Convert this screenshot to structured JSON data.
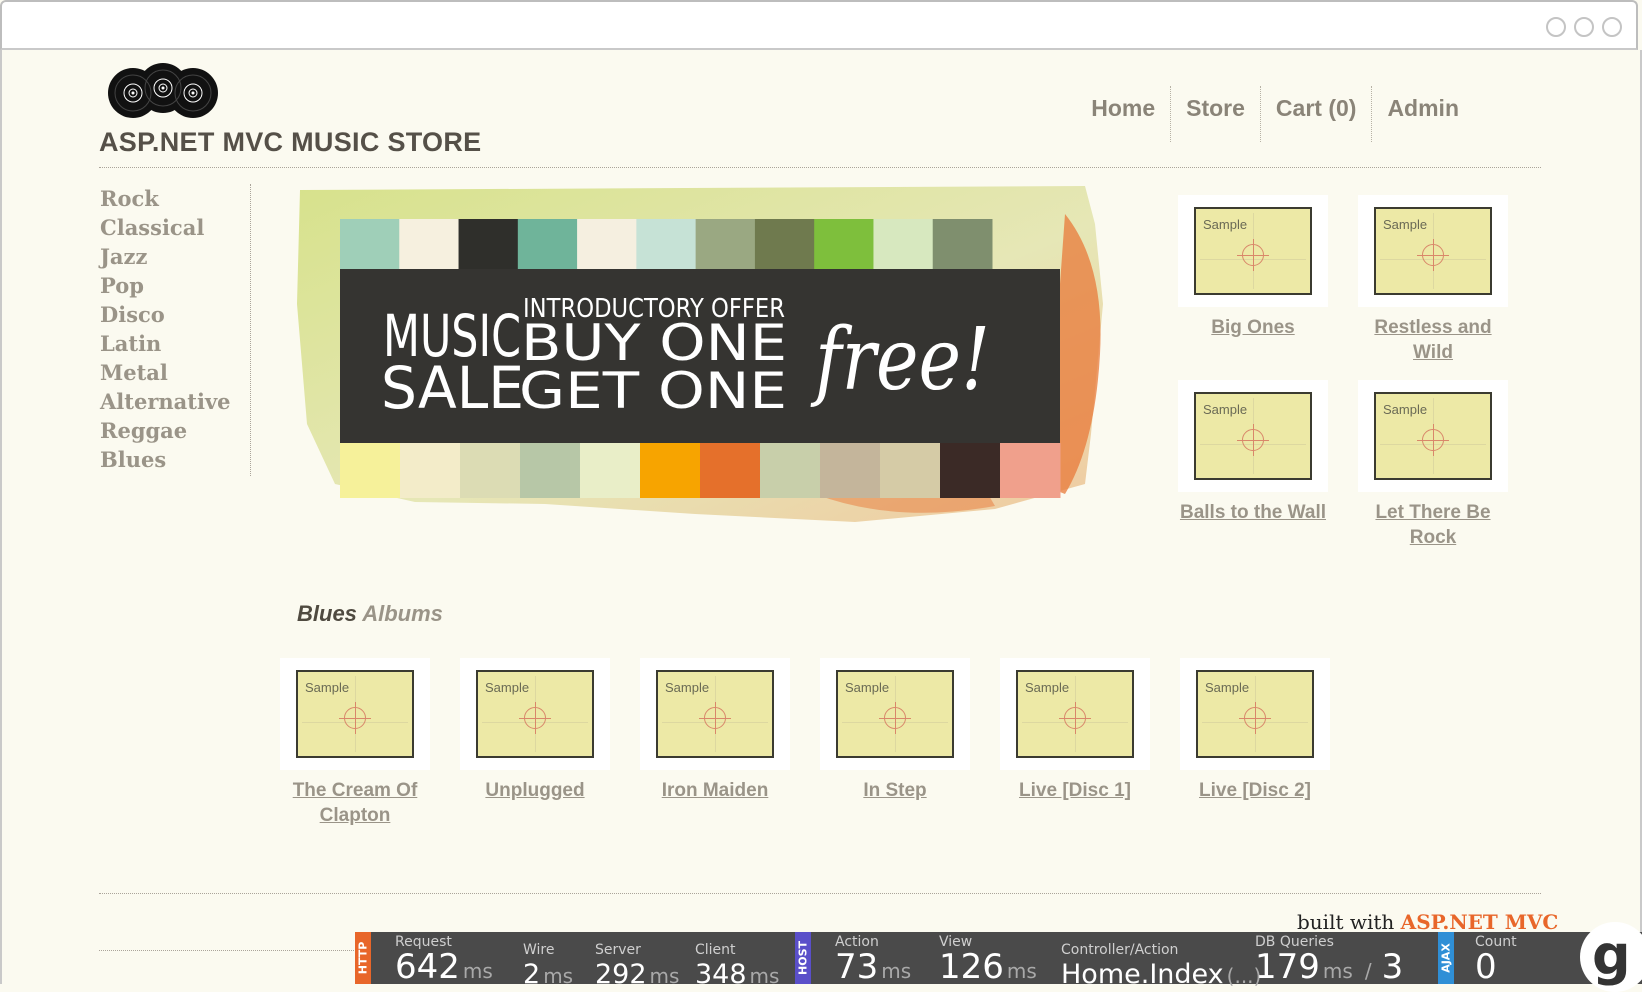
{
  "site": {
    "title": "ASP.NET MVC MUSIC STORE"
  },
  "nav": [
    {
      "label": "Home"
    },
    {
      "label": "Store"
    },
    {
      "label": "Cart (0)"
    },
    {
      "label": "Admin"
    }
  ],
  "genres": [
    "Rock",
    "Classical",
    "Jazz",
    "Pop",
    "Disco",
    "Latin",
    "Metal",
    "Alternative",
    "Reggae",
    "Blues"
  ],
  "banner": {
    "line1": "MUSIC",
    "line2": "SALE",
    "offer": "INTRODUCTORY OFFER",
    "buy": "BUY ONE",
    "get": "GET ONE",
    "free": "free!",
    "colors_top": [
      "#9fcfb8",
      "#f6f0df",
      "#2f2f2b",
      "#6fb49a",
      "#f5efe0",
      "#c6e2d6",
      "#9aa882",
      "#6f7a4e",
      "#7ebf3c",
      "#d7e8bf",
      "#7f8f6e"
    ],
    "colors_bottom": [
      "#f6f19a",
      "#f3ecc9",
      "#dcdcb4",
      "#b7c7a7",
      "#e9eec8",
      "#f7a400",
      "#e5702b",
      "#c8cfaa",
      "#c4b59b",
      "#d5cba6",
      "#3b2a26",
      "#f0a08c"
    ]
  },
  "sample_label": "Sample",
  "featured": [
    {
      "title": "Big Ones"
    },
    {
      "title": "Restless and Wild"
    },
    {
      "title": "Balls to the Wall"
    },
    {
      "title": "Let There Be Rock"
    }
  ],
  "genre_section": {
    "genre": "Blues",
    "suffix": "Albums"
  },
  "albums": [
    {
      "title": "The Cream Of Clapton"
    },
    {
      "title": "Unplugged"
    },
    {
      "title": "Iron Maiden"
    },
    {
      "title": "In Step"
    },
    {
      "title": "Live [Disc 1]"
    },
    {
      "title": "Live [Disc 2]"
    }
  ],
  "footer": {
    "built_with": "built with ",
    "tech": "ASP.NET MVC"
  },
  "glimpse": {
    "tags": {
      "http": "HTTP",
      "host": "HOST",
      "ajax": "AJAX"
    },
    "request": {
      "label": "Request",
      "value": "642",
      "unit": "ms"
    },
    "wire": {
      "label": "Wire",
      "value": "2",
      "unit": "ms"
    },
    "server": {
      "label": "Server",
      "value": "292",
      "unit": "ms"
    },
    "client": {
      "label": "Client",
      "value": "348",
      "unit": "ms"
    },
    "action": {
      "label": "Action",
      "value": "73",
      "unit": "ms"
    },
    "view": {
      "label": "View",
      "value": "126",
      "unit": "ms"
    },
    "controller": {
      "label": "Controller/Action",
      "value": "Home.Index",
      "extra": "(...)"
    },
    "db": {
      "label": "DB Queries",
      "value": "179",
      "unit": "ms",
      "sep": "/",
      "count": "3"
    },
    "ajax": {
      "label": "Count",
      "value": "0"
    },
    "logo": "g",
    "colors": {
      "http": "#e8662a",
      "host": "#5a4fc9",
      "ajax": "#2f8fd6"
    }
  }
}
